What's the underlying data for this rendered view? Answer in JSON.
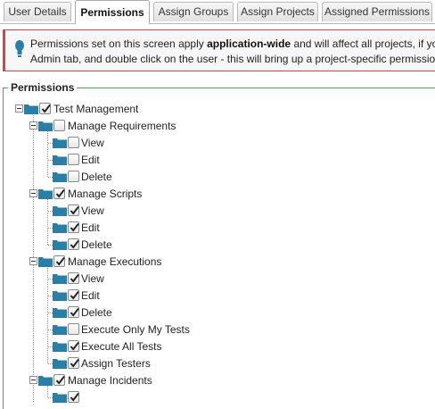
{
  "tabs": [
    {
      "label": "User Details",
      "active": false
    },
    {
      "label": "Permissions",
      "active": true
    },
    {
      "label": "Assign Groups",
      "active": false
    },
    {
      "label": "Assign Projects",
      "active": false
    },
    {
      "label": "Assigned Permissions",
      "active": false
    }
  ],
  "notice": {
    "icon": "lightbulb-icon",
    "text_before": "Permissions set on this screen apply ",
    "text_bold": "application-wide",
    "text_after": " and will affect all projects, if you wan",
    "line2": "Admin tab, and double click on the user - this will bring up a project-specific permission editing"
  },
  "permissions_section": {
    "legend": "Permissions",
    "tree": [
      {
        "label": "Test Management",
        "checked": true,
        "level": 0
      },
      {
        "label": "Manage Requirements",
        "checked": false,
        "level": 1
      },
      {
        "label": "View",
        "checked": false,
        "level": 2
      },
      {
        "label": "Edit",
        "checked": false,
        "level": 2
      },
      {
        "label": "Delete",
        "checked": false,
        "level": 2
      },
      {
        "label": "Manage Scripts",
        "checked": true,
        "level": 1
      },
      {
        "label": "View",
        "checked": true,
        "level": 2
      },
      {
        "label": "Edit",
        "checked": true,
        "level": 2
      },
      {
        "label": "Delete",
        "checked": true,
        "level": 2
      },
      {
        "label": "Manage Executions",
        "checked": true,
        "level": 1
      },
      {
        "label": "View",
        "checked": true,
        "level": 2
      },
      {
        "label": "Edit",
        "checked": true,
        "level": 2
      },
      {
        "label": "Delete",
        "checked": true,
        "level": 2
      },
      {
        "label": "Execute Only My Tests",
        "checked": false,
        "level": 2
      },
      {
        "label": "Execute All Tests",
        "checked": true,
        "level": 2
      },
      {
        "label": "Assign Testers",
        "checked": true,
        "level": 2
      },
      {
        "label": "Manage Incidents",
        "checked": true,
        "level": 1
      },
      {
        "label": "",
        "checked": true,
        "level": 2
      }
    ]
  },
  "colors": {
    "folder": "#2a7fa9",
    "fieldset_border": "#3fae3f",
    "notice_border": "#d64545",
    "icon": "#2a7fa9"
  }
}
